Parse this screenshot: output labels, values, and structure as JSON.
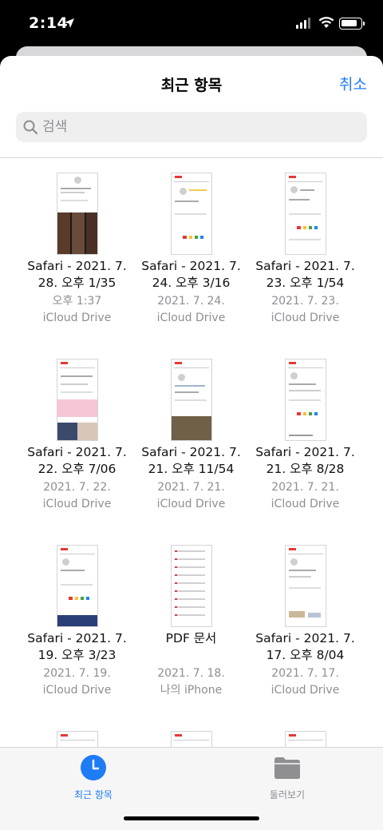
{
  "status_bar": {
    "time": "2:14"
  },
  "header": {
    "title": "최근 항목",
    "cancel_label": "취소"
  },
  "search": {
    "placeholder": "검색"
  },
  "files": [
    {
      "name": "Safari - 2021. 7. 28. 오후 1/35",
      "date": "오후 1:37",
      "location": "iCloud Drive"
    },
    {
      "name": "Safari - 2021. 7. 24. 오후 3/16",
      "date": "2021. 7. 24.",
      "location": "iCloud Drive"
    },
    {
      "name": "Safari - 2021. 7. 23. 오후 1/54",
      "date": "2021. 7. 23.",
      "location": "iCloud Drive"
    },
    {
      "name": "Safari - 2021. 7. 22. 오후 7/06",
      "date": "2021. 7. 22.",
      "location": "iCloud Drive"
    },
    {
      "name": "Safari - 2021. 7. 21. 오후 11/54",
      "date": "2021. 7. 21.",
      "location": "iCloud Drive"
    },
    {
      "name": "Safari - 2021. 7. 21. 오후 8/28",
      "date": "2021. 7. 21.",
      "location": "iCloud Drive"
    },
    {
      "name": "Safari - 2021. 7. 19. 오후 3/23",
      "date": "2021. 7. 19.",
      "location": "iCloud Drive"
    },
    {
      "name": "PDF 문서",
      "date": "2021. 7. 18.",
      "location": "나의 iPhone"
    },
    {
      "name": "Safari - 2021. 7. 17. 오후 8/04",
      "date": "2021. 7. 17.",
      "location": "iCloud Drive"
    }
  ],
  "tab_bar": {
    "recent_label": "최근 항목",
    "browse_label": "둘러보기",
    "active_color": "#1e7cf5",
    "inactive_color": "#8e8e93"
  },
  "icons": [
    "location-arrow-icon",
    "signal-icon",
    "wifi-icon",
    "battery-icon",
    "search-icon",
    "clock-icon",
    "folder-icon"
  ]
}
